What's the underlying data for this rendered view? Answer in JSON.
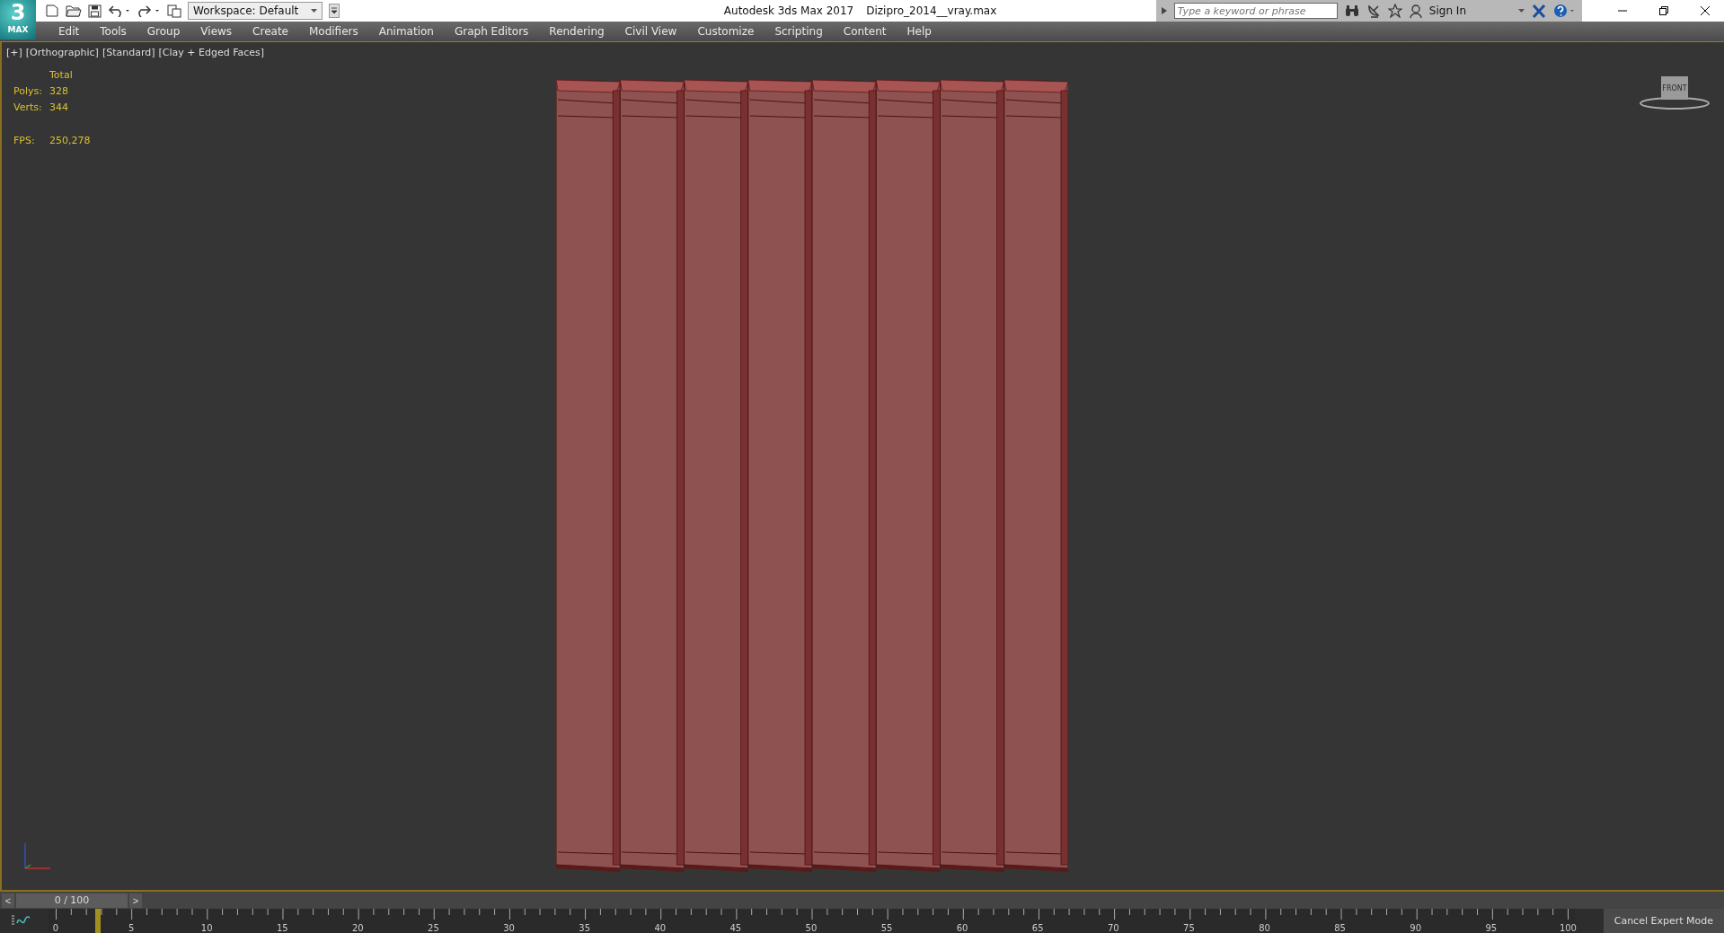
{
  "title_bar": {
    "logo": "3",
    "logo_sub": "MAX",
    "workspace": "Workspace: Default",
    "app_title": "Autodesk 3ds Max 2017",
    "file_name": "Dizipro_2014__vray.max",
    "search": {
      "placeholder": "Type a keyword or phrase"
    },
    "sign_in": "Sign In"
  },
  "menu": [
    "Edit",
    "Tools",
    "Group",
    "Views",
    "Create",
    "Modifiers",
    "Animation",
    "Graph Editors",
    "Rendering",
    "Civil View",
    "Customize",
    "Scripting",
    "Content",
    "Help"
  ],
  "viewport": {
    "labels": [
      "[+]",
      "[Orthographic]",
      "[Standard]",
      "[Clay + Edged Faces]"
    ],
    "stats": {
      "header": "Total",
      "rows": [
        {
          "label": "Polys:",
          "value": "328"
        },
        {
          "label": "Verts:",
          "value": "344"
        }
      ],
      "fps_label": "FPS:",
      "fps_value": "250,278"
    },
    "viewcube": "FRONT"
  },
  "time_slider": {
    "prev": "<",
    "position": "0 / 100",
    "next": ">"
  },
  "trackbar": {
    "ticks": [
      "0",
      "5",
      "10",
      "15",
      "20",
      "25",
      "30",
      "35",
      "40",
      "45",
      "50",
      "55",
      "60",
      "65",
      "70",
      "75",
      "80",
      "85",
      "90",
      "95",
      "100"
    ]
  },
  "expert_button": "Cancel Expert Mode"
}
